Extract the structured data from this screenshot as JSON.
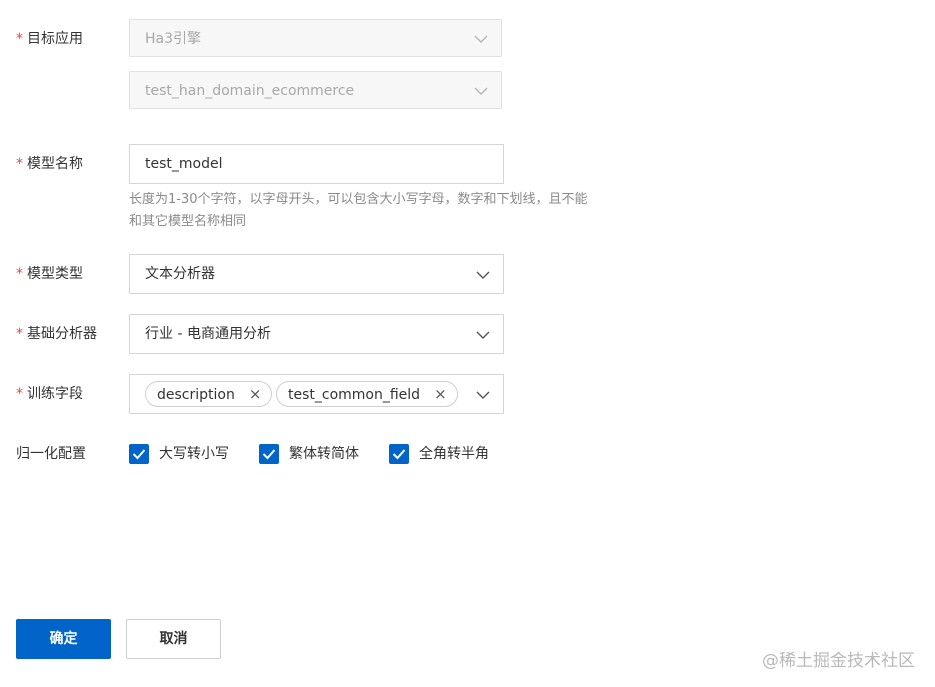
{
  "form": {
    "target_app": {
      "label": "目标应用",
      "engine_value": "Ha3引擎",
      "instance_value": "test_han_domain_ecommerce"
    },
    "model_name": {
      "label": "模型名称",
      "value": "test_model",
      "hint": "长度为1-30个字符，以字母开头，可以包含大小写字母，数字和下划线，且不能和其它模型名称相同"
    },
    "model_type": {
      "label": "模型类型",
      "value": "文本分析器"
    },
    "base_analyzer": {
      "label": "基础分析器",
      "value": "行业 - 电商通用分析"
    },
    "train_fields": {
      "label": "训练字段",
      "tags": [
        "description",
        "test_common_field"
      ],
      "remove_glyph": "×"
    },
    "normalization": {
      "label": "归一化配置",
      "options": [
        {
          "label": "大写转小写",
          "checked": true
        },
        {
          "label": "繁体转简体",
          "checked": true
        },
        {
          "label": "全角转半角",
          "checked": true
        }
      ]
    },
    "required_mark": "*"
  },
  "actions": {
    "confirm_label": "确定",
    "cancel_label": "取消"
  },
  "watermark": "@稀土掘金技术社区",
  "colors": {
    "primary": "#0064c8",
    "required": "#e54545",
    "hint": "#8a8a8a"
  }
}
